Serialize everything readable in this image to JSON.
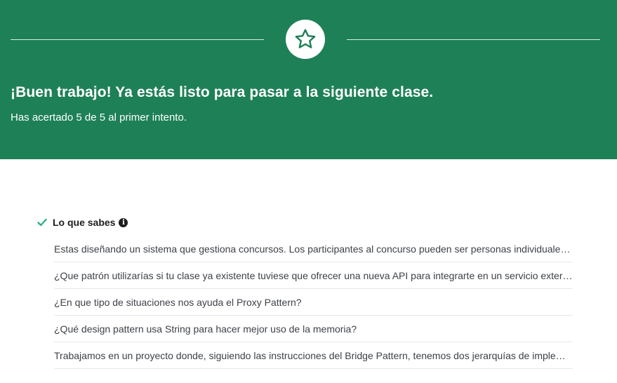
{
  "banner": {
    "icon": "star-icon",
    "background_color": "#1e8057",
    "title": "¡Buen trabajo! Ya estás listo para pasar a la siguiente clase.",
    "subtitle": "Has acertado 5 de 5 al primer intento."
  },
  "knowledge": {
    "icon": "check-icon",
    "check_color": "#2bb07f",
    "title": "Lo que sabes",
    "info_icon": "info-icon",
    "questions": [
      "Estas diseñando un sistema que gestiona concursos. Los participantes al concurso pueden ser personas individuales o equipos",
      "¿Que patrón utilizarías si tu clase ya existente tuviese que ofrecer una nueva API para integrarte en un servicio externo?",
      "¿En que tipo de situaciones nos ayuda el Proxy Pattern?",
      "¿Qué design pattern usa String para hacer mejor uso de la memoria?",
      "Trabajamos en un proyecto donde, siguiendo las instrucciones del Bridge Pattern, tenemos dos jerarquías de implementación"
    ]
  }
}
